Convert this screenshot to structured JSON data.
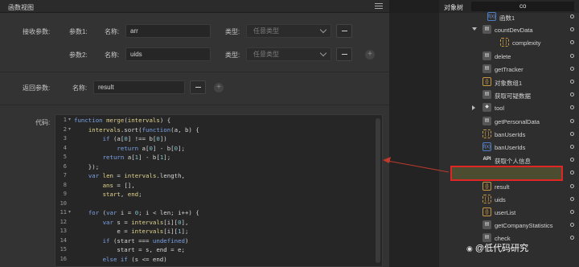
{
  "panel": {
    "title": "函数视图"
  },
  "params": {
    "receive_label": "接收参数:",
    "rows": [
      {
        "label": "参数1:",
        "name_label": "名称:",
        "name_value": "arr",
        "type_label": "类型:",
        "type_placeholder": "任意类型"
      },
      {
        "label": "参数2:",
        "name_label": "名称:",
        "name_value": "uids",
        "type_label": "类型:",
        "type_placeholder": "任意类型"
      }
    ]
  },
  "returns": {
    "label": "返回参数:",
    "name_label": "名称:",
    "name_value": "result"
  },
  "code": {
    "label": "代码:",
    "line_numbers": [
      "1",
      "2",
      "3",
      "4",
      "5",
      "6",
      "7",
      "8",
      "9",
      "10",
      "11",
      "12",
      "13",
      "14",
      "15",
      "16"
    ]
  },
  "tree": {
    "tab_label": "对象树",
    "search_value": "co",
    "items": [
      {
        "label": "函数1",
        "icon": "function-icon"
      },
      {
        "label": "countDevData",
        "icon": "bar-icon"
      },
      {
        "label": "complexity",
        "icon": "array-icon"
      },
      {
        "label": "delete",
        "icon": "bar-icon"
      },
      {
        "label": "getTracker",
        "icon": "bar-icon"
      },
      {
        "label": "对象数组1",
        "icon": "object-icon"
      },
      {
        "label": "获取可疑数据",
        "icon": "bar-icon"
      },
      {
        "label": "tool",
        "icon": "stack-icon"
      },
      {
        "label": "getPersonalData",
        "icon": "bar-icon"
      },
      {
        "label": "banUserIds",
        "icon": "array-icon"
      },
      {
        "label": "banUserIds",
        "icon": "function-icon"
      },
      {
        "label": "获取个人信息",
        "icon": "api-icon"
      },
      {
        "label": "merge",
        "icon": "function-icon"
      },
      {
        "label": "result",
        "icon": "object-icon"
      },
      {
        "label": "uids",
        "icon": "array-icon"
      },
      {
        "label": "userList",
        "icon": "object-icon"
      },
      {
        "label": "getCompanyStatistics",
        "icon": "bar-icon"
      },
      {
        "label": "check",
        "icon": "bar-icon"
      }
    ]
  },
  "watermark": {
    "text": "@低代码研究"
  },
  "colors": {
    "highlight": "#e02525",
    "arrow": "#c0392b"
  }
}
